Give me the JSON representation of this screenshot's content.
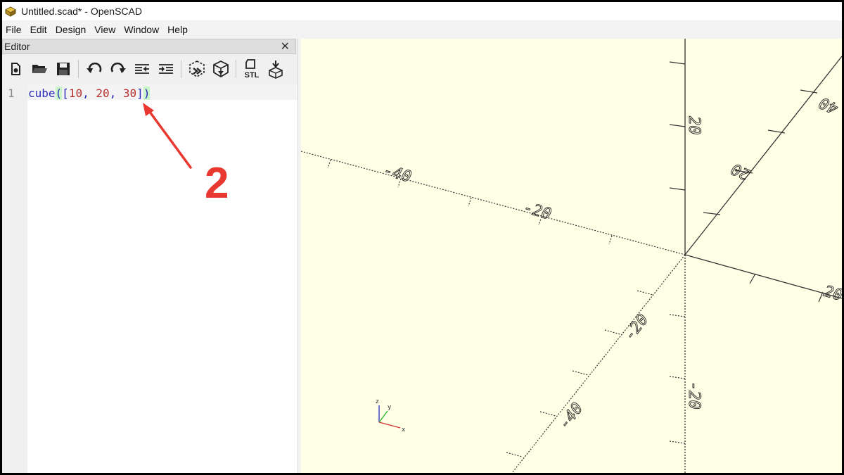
{
  "window": {
    "title": "Untitled.scad* - OpenSCAD",
    "icon": "openscad-icon"
  },
  "menu": [
    "File",
    "Edit",
    "Design",
    "View",
    "Window",
    "Help"
  ],
  "editor": {
    "panel_title": "Editor",
    "close_glyph": "✕",
    "toolbar": [
      "new-file-icon",
      "open-file-icon",
      "save-icon",
      "undo-icon",
      "redo-icon",
      "unindent-icon",
      "indent-icon",
      "preview-icon",
      "render-icon",
      "export-stl-icon",
      "send-to-print-icon"
    ],
    "toolbar_stl_label": "STL",
    "line_number": "1",
    "code": {
      "keyword": "cube",
      "open_paren": "(",
      "open_bracket": "[",
      "n1": "10",
      "comma1": ", ",
      "n2": "20",
      "comma2": ", ",
      "n3": "30",
      "close_bracket": "]",
      "close_paren": ")"
    }
  },
  "annotation": {
    "label": "2",
    "color": "#e8382f"
  },
  "viewport": {
    "background": "#ffffe6",
    "axis_labels": {
      "x_neg_40": "-40",
      "x_neg_20": "-20",
      "x_pos_20": "20",
      "z_pos_20": "20",
      "z_neg_20": "-20",
      "y_pos_20": "20",
      "y_pos_40": "40",
      "y_neg_20": "-20",
      "y_neg_40": "-40"
    },
    "gizmo": {
      "x": "x",
      "y": "y",
      "z": "z"
    }
  }
}
